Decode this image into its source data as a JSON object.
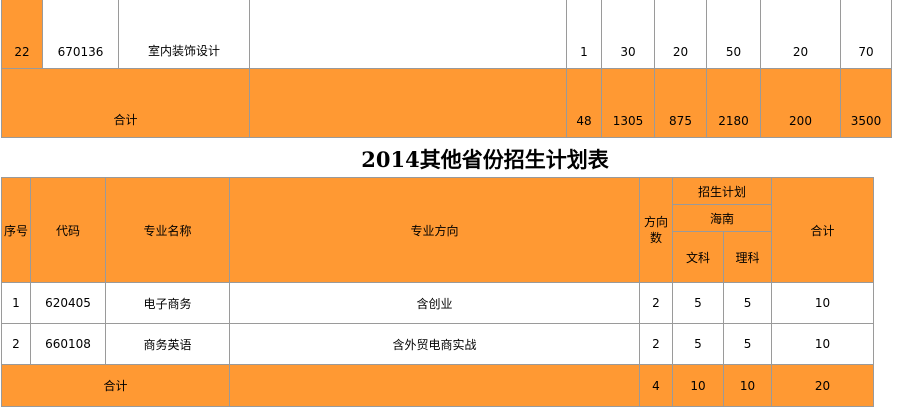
{
  "top_table": {
    "row": {
      "seq": "22",
      "code": "670136",
      "name": "室内装饰设计",
      "direction": "",
      "c1": "1",
      "c2": "30",
      "c3": "20",
      "c4": "50",
      "c5": "20",
      "c6": "70"
    },
    "total": {
      "label": "合计",
      "direction": "",
      "c1": "48",
      "c2": "1305",
      "c3": "875",
      "c4": "2180",
      "c5": "200",
      "c6": "3500"
    }
  },
  "title": "2014其他省份招生计划表",
  "main_table": {
    "headers": {
      "seq": "序号",
      "code": "代码",
      "name": "专业名称",
      "direction": "专业方向",
      "direction_count": "方向\n数",
      "plan": "招生计划",
      "province": "海南",
      "arts": "文科",
      "science": "理科",
      "total": "合计"
    },
    "rows": [
      {
        "seq": "1",
        "code": "620405",
        "name": "电子商务",
        "direction": "含创业",
        "count": "2",
        "arts": "5",
        "science": "5",
        "total": "10"
      },
      {
        "seq": "2",
        "code": "660108",
        "name": "商务英语",
        "direction": "含外贸电商实战",
        "count": "2",
        "arts": "5",
        "science": "5",
        "total": "10"
      }
    ],
    "total": {
      "label": "合计",
      "direction": "",
      "count": "4",
      "arts": "10",
      "science": "10",
      "total": "20"
    }
  },
  "colors": {
    "header_bg": "#ff9933",
    "cell_bg": "#ffffff",
    "border": "#9a9a9a"
  }
}
